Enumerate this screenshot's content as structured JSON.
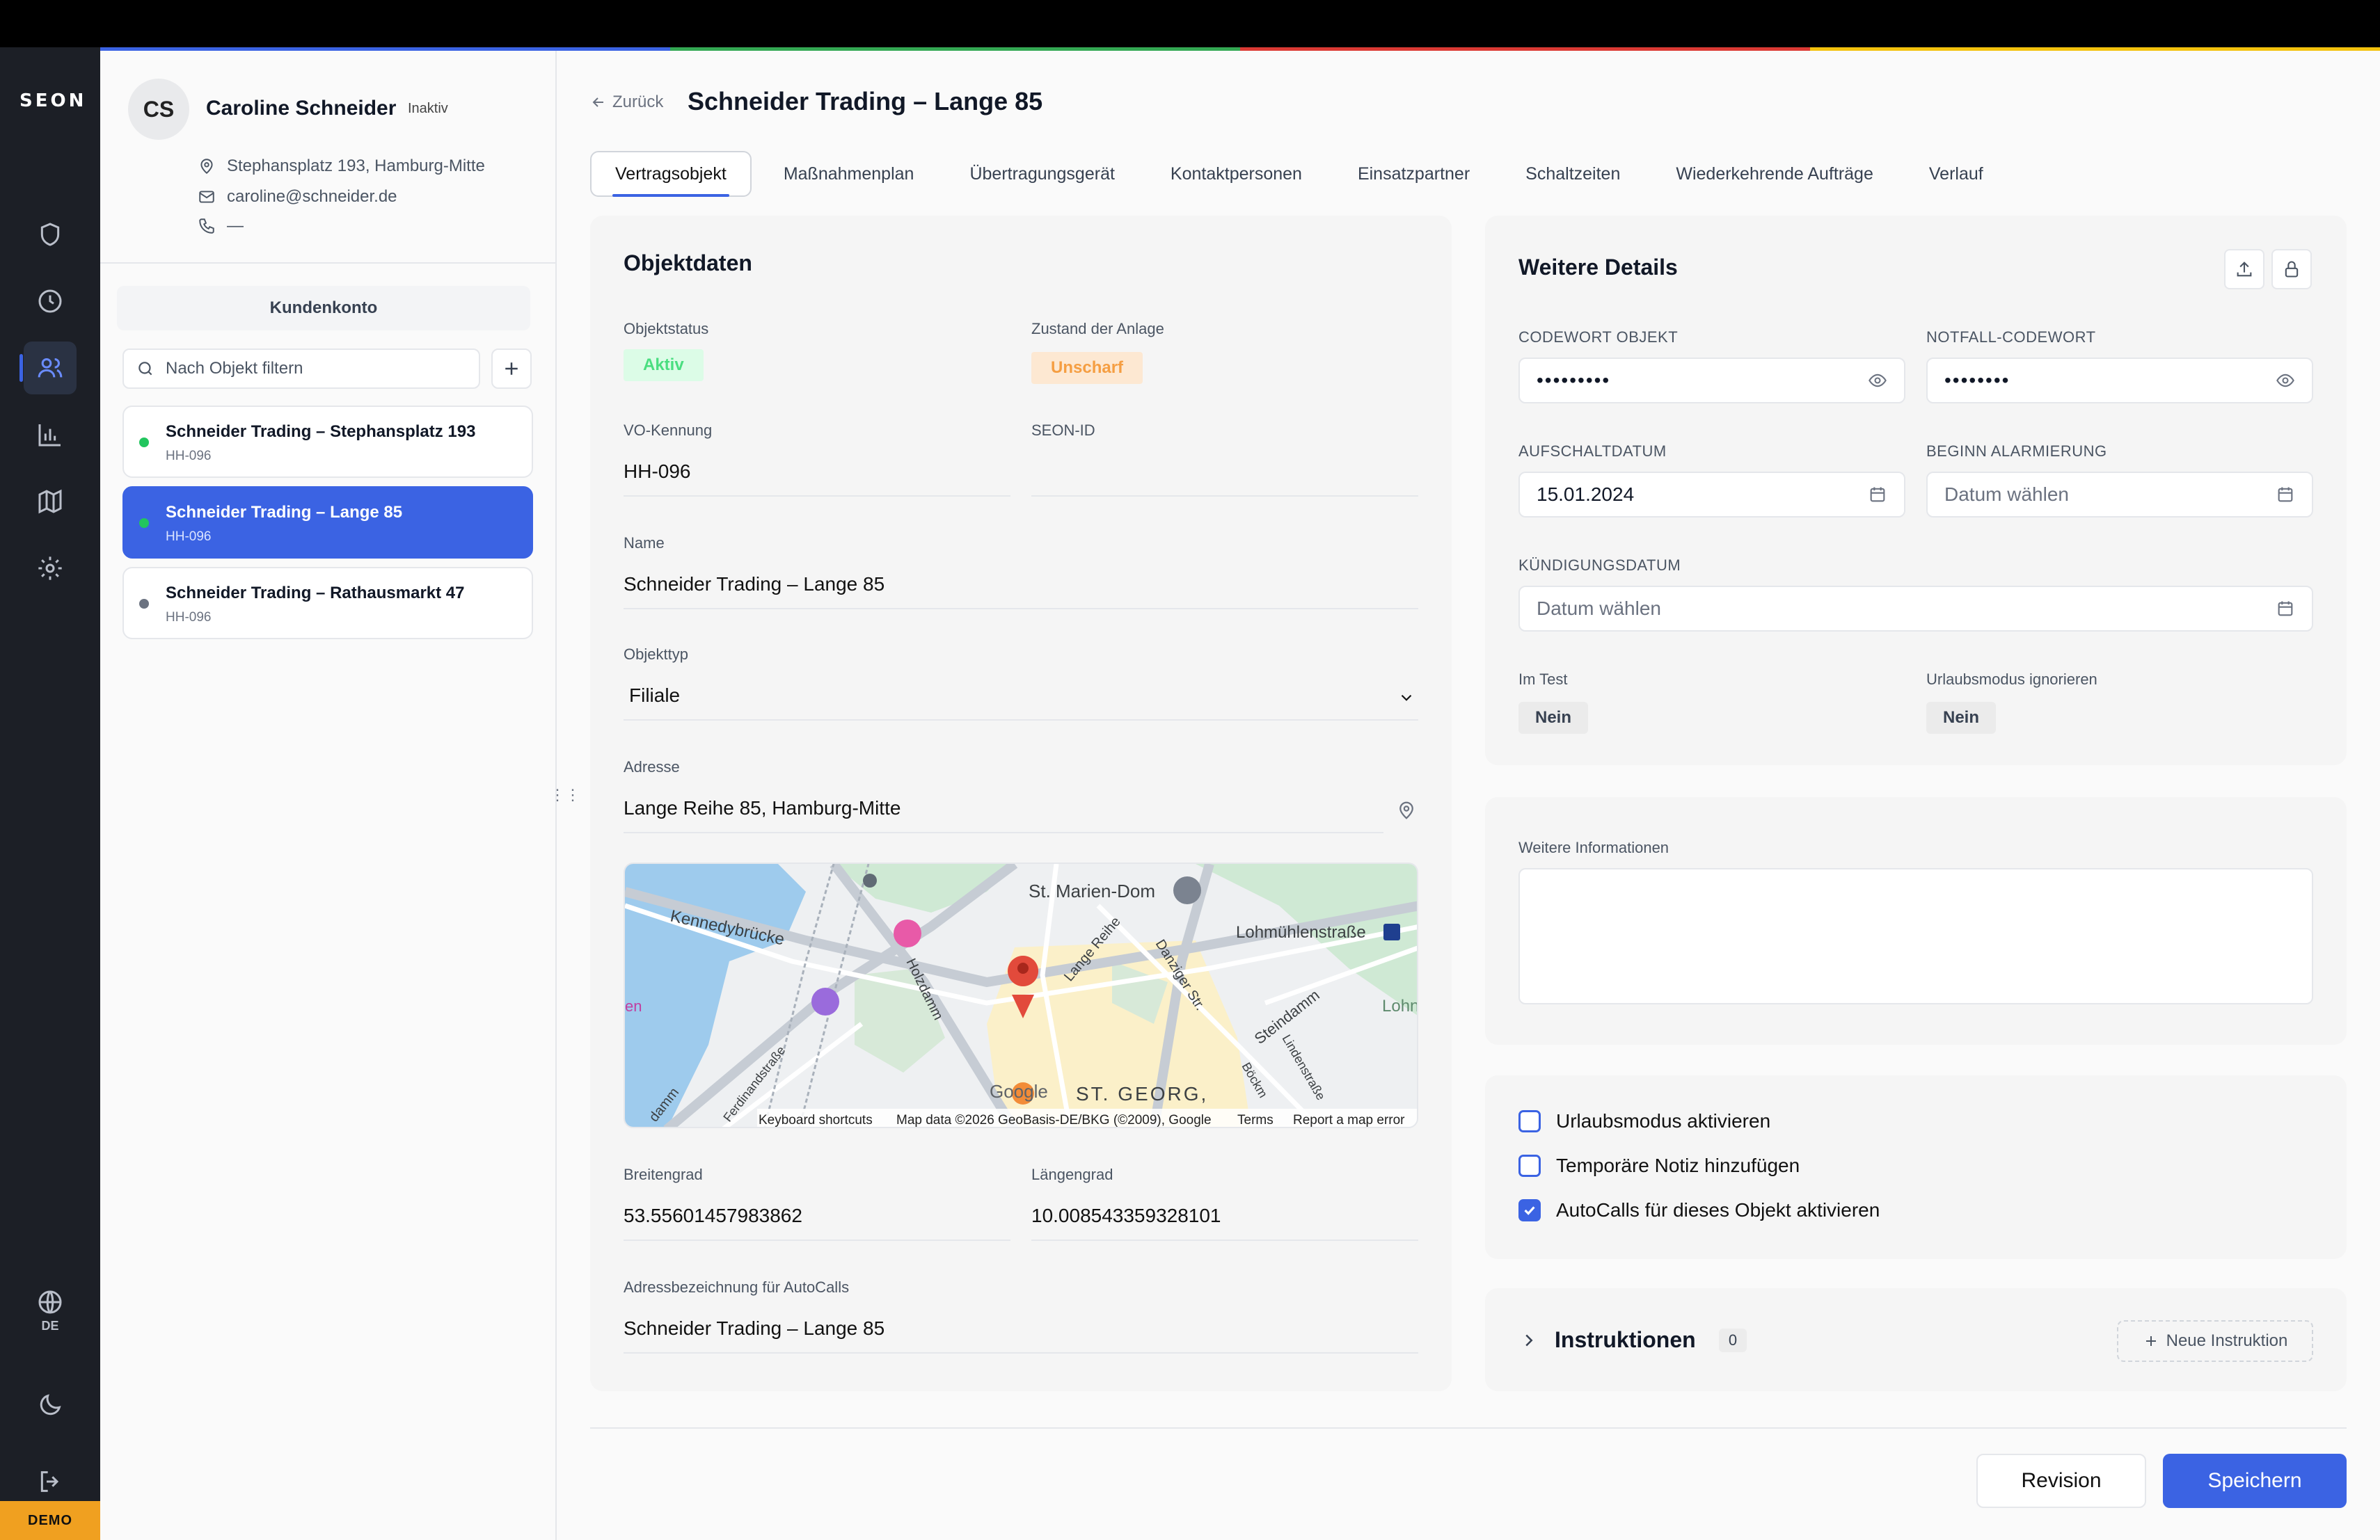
{
  "app": {
    "logo": "SEON",
    "language": "DE",
    "env_badge": "DEMO"
  },
  "colors": {
    "accent": "#3b63e3",
    "rainbow": [
      "#3b63e3",
      "#34a853",
      "#db3a34",
      "#f4c20d"
    ],
    "rail_bg": "#1c1f26"
  },
  "rail": {
    "icons": [
      "shield-icon",
      "clock-icon",
      "users-icon",
      "bar-chart-icon",
      "map-icon",
      "gear-icon"
    ],
    "active": "users-icon"
  },
  "customer": {
    "initials": "CS",
    "name": "Caroline Schneider",
    "status": "Inaktiv",
    "address": "Stephansplatz 193, Hamburg-Mitte",
    "email": "caroline@schneider.de",
    "phone": "—"
  },
  "sidebar": {
    "account_label": "Kundenkonto",
    "filter_placeholder": "Nach Objekt filtern",
    "objects": [
      {
        "title": "Schneider Trading – Stephansplatz 193",
        "code": "HH-096",
        "dot": "#22c55e"
      },
      {
        "title": "Schneider Trading – Lange 85",
        "code": "HH-096",
        "dot": "#22c55e"
      },
      {
        "title": "Schneider Trading – Rathausmarkt 47",
        "code": "HH-096",
        "dot": "#6b7280"
      }
    ]
  },
  "header": {
    "back": "Zurück",
    "title": "Schneider Trading – Lange 85"
  },
  "tabs": [
    "Vertragsobjekt",
    "Maßnahmenplan",
    "Übertragungsgerät",
    "Kontaktpersonen",
    "Einsatzpartner",
    "Schaltzeiten",
    "Wiederkehrende Aufträge",
    "Verlauf"
  ],
  "objektdaten": {
    "title": "Objektdaten",
    "status_label": "Objektstatus",
    "status_value": "Aktiv",
    "zustand_label": "Zustand der Anlage",
    "zustand_value": "Unscharf",
    "vo_label": "VO-Kennung",
    "vo_value": "HH-096",
    "seon_label": "SEON-ID",
    "seon_value": "",
    "name_label": "Name",
    "name_value": "Schneider Trading – Lange 85",
    "typ_label": "Objekttyp",
    "typ_value": "Filiale",
    "adresse_label": "Adresse",
    "adresse_value": "Lange Reihe 85, Hamburg-Mitte",
    "map": {
      "labels": [
        "St. Marien-Dom",
        "Kennedybrücke",
        "Lohmühlenstraße",
        "Holzdamm",
        "Lange Reihe",
        "Danziger Str.",
        "Steindamm",
        "Lohn",
        "Böckm",
        "Lindenstraße",
        "ST. GEORG,",
        "Ferdinandstraße",
        "damm",
        "en"
      ],
      "footer": [
        "Keyboard shortcuts",
        "Map data ©2026 GeoBasis-DE/BKG (©2009), Google",
        "Terms",
        "Report a map error"
      ],
      "brand": "Google"
    },
    "lat_label": "Breitengrad",
    "lat_value": "53.55601457983862",
    "lng_label": "Längengrad",
    "lng_value": "10.008543359328101",
    "autocall_label": "Adressbezeichnung für AutoCalls",
    "autocall_value": "Schneider Trading – Lange 85"
  },
  "details": {
    "title": "Weitere Details",
    "codewort_label": "CODEWORT OBJEKT",
    "codewort_value": "•••••••••",
    "notfall_label": "NOTFALL-CODEWORT",
    "notfall_value": "••••••••",
    "aufschalt_label": "AUFSCHALTDATUM",
    "aufschalt_value": "15.01.2024",
    "beginn_label": "BEGINN ALARMIERUNG",
    "beginn_placeholder": "Datum wählen",
    "kuendigung_label": "KÜNDIGUNGSDATUM",
    "kuendigung_placeholder": "Datum wählen",
    "test_label": "Im Test",
    "test_value": "Nein",
    "urlaub_ign_label": "Urlaubsmodus ignorieren",
    "urlaub_ign_value": "Nein"
  },
  "info": {
    "label": "Weitere Informationen",
    "value": ""
  },
  "checks": [
    {
      "label": "Urlaubsmodus aktivieren",
      "checked": false
    },
    {
      "label": "Temporäre Notiz hinzufügen",
      "checked": false
    },
    {
      "label": "AutoCalls für dieses Objekt aktivieren",
      "checked": true
    }
  ],
  "instr": {
    "title": "Instruktionen",
    "count": "0",
    "new_label": "Neue Instruktion"
  },
  "footer": {
    "revision": "Revision",
    "save": "Speichern"
  }
}
